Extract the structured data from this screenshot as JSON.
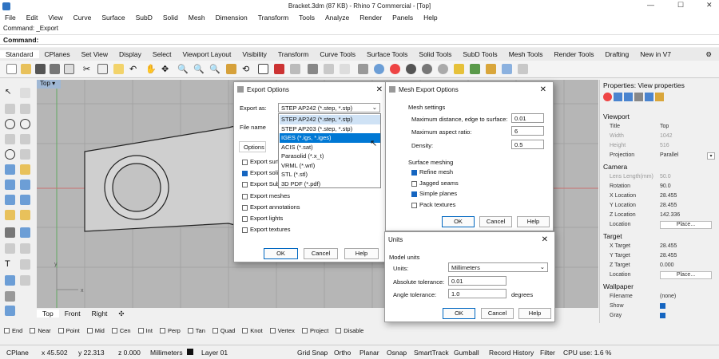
{
  "title_bar": {
    "title": "Bracket.3dm (87 KB) - Rhino 7 Commercial - [Top]"
  },
  "menu": [
    "File",
    "Edit",
    "View",
    "Curve",
    "Surface",
    "SubD",
    "Solid",
    "Mesh",
    "Dimension",
    "Transform",
    "Tools",
    "Analyze",
    "Render",
    "Panels",
    "Help"
  ],
  "command": {
    "history": "Command: _Export",
    "prompt_label": "Command:"
  },
  "toolbar_tabs": [
    "Standard",
    "CPlanes",
    "Set View",
    "Display",
    "Select",
    "Viewport Layout",
    "Visibility",
    "Transform",
    "Curve Tools",
    "Surface Tools",
    "Solid Tools",
    "SubD Tools",
    "Mesh Tools",
    "Render Tools",
    "Drafting",
    "New in V7"
  ],
  "viewport": {
    "label": "Top",
    "tabs": [
      "Top",
      "Front",
      "Right"
    ],
    "axis_x": "x",
    "axis_y": "y"
  },
  "osnap": [
    "End",
    "Near",
    "Point",
    "Mid",
    "Cen",
    "Int",
    "Perp",
    "Tan",
    "Quad",
    "Knot",
    "Vertex",
    "Project",
    "Disable"
  ],
  "status": {
    "cplane": "CPlane",
    "x": "x 45.502",
    "y": "y 22.313",
    "z": "z 0.000",
    "units": "Millimeters",
    "layer": "Layer 01",
    "grid_snap": "Grid Snap",
    "ortho": "Ortho",
    "planar": "Planar",
    "osnap": "Osnap",
    "smarttrack": "SmartTrack",
    "gumball": "Gumball",
    "record_history": "Record History",
    "filter": "Filter",
    "cpu": "CPU use: 1.6 %"
  },
  "properties": {
    "header": "Properties: View properties",
    "viewport_section": "Viewport",
    "title_label": "Title",
    "title_val": "Top",
    "width_label": "Width",
    "width_val": "1042",
    "height_label": "Height",
    "height_val": "516",
    "projection_label": "Projection",
    "projection_val": "Parallel",
    "camera_section": "Camera",
    "lens_label": "Lens Length(mm)",
    "lens_val": "50.0",
    "rotation_label": "Rotation",
    "rotation_val": "90.0",
    "cx_label": "X Location",
    "cx_val": "28.455",
    "cy_label": "Y Location",
    "cy_val": "28.455",
    "cz_label": "Z Location",
    "cz_val": "142.336",
    "location_label": "Location",
    "place_label": "Place...",
    "target_section": "Target",
    "tx_label": "X Target",
    "tx_val": "28.455",
    "ty_label": "Y Target",
    "ty_val": "28.455",
    "tz_label": "Z Target",
    "tz_val": "0.000",
    "tloc_label": "Location",
    "tplace_label": "Place...",
    "wallpaper_section": "Wallpaper",
    "filename_label": "Filename",
    "filename_val": "(none)",
    "show_label": "Show",
    "gray_label": "Gray"
  },
  "export_options": {
    "title": "Export Options",
    "export_as_label": "Export as:",
    "export_as_value": "STEP AP242 (*.step, *.stp)",
    "file_name_label": "File name",
    "options_tab": "Options",
    "dropdown_items": [
      "STEP AP242 (*.step, *.stp)",
      "STEP AP203 (*.step, *.stp)",
      "IGES (*.igs, *.iges)",
      "ACIS (*.sat)",
      "Parasolid (*.x_t)",
      "VRML (*.wrl)",
      "STL (*.stl)",
      "3D PDF (*.pdf)"
    ],
    "checks": [
      "Export surfaces",
      "Export solids",
      "Export SubD",
      "Export meshes",
      "Export annotations",
      "Export lights",
      "Export textures"
    ],
    "ok": "OK",
    "cancel": "Cancel",
    "help": "Help"
  },
  "mesh_export": {
    "title": "Mesh Export Options",
    "settings_label": "Mesh settings",
    "max_dist_label": "Maximum distance, edge to surface:",
    "max_dist_val": "0.01",
    "max_aspect_label": "Maximum aspect ratio:",
    "max_aspect_val": "6",
    "density_label": "Density:",
    "density_val": "0.5",
    "surface_meshing_label": "Surface meshing",
    "refine": "Refine mesh",
    "jagged": "Jagged seams",
    "simple": "Simple planes",
    "pack": "Pack textures",
    "ok": "OK",
    "cancel": "Cancel",
    "help": "Help"
  },
  "units": {
    "title": "Units",
    "model_units_label": "Model units",
    "units_label": "Units:",
    "units_val": "Millimeters",
    "abs_tol_label": "Absolute tolerance:",
    "abs_tol_val": "0.01",
    "ang_tol_label": "Angle tolerance:",
    "ang_tol_val": "1.0",
    "degrees": "degrees",
    "ok": "OK",
    "cancel": "Cancel",
    "help": "Help"
  }
}
